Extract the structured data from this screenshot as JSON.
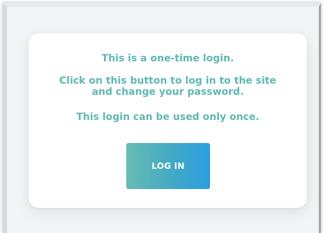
{
  "dialog": {
    "line1": "This is a one-time login.",
    "line2a": "Click on this button to log in to the site",
    "line2b": "and change your password.",
    "line3": "This login can be used only once.",
    "button_label": "LOG IN"
  },
  "colors": {
    "text": "#5fb8b0",
    "button_start": "#66bcb0",
    "button_end": "#2a9ee0",
    "button_text": "#ffffff",
    "card_bg": "#ffffff",
    "frame_bg": "#f2f4f5"
  }
}
